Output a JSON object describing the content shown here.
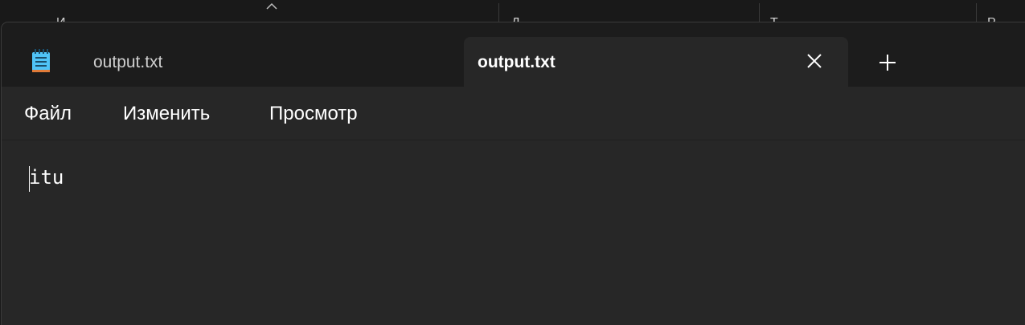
{
  "background_window": {
    "column_labels": [
      "И",
      "Д",
      "Т",
      "Р"
    ]
  },
  "notepad": {
    "tabs": [
      {
        "label": "output.txt",
        "active": false
      },
      {
        "label": "output.txt",
        "active": true
      }
    ],
    "menu": {
      "file": "Файл",
      "edit": "Изменить",
      "view": "Просмотр"
    },
    "editor": {
      "content": "itu"
    }
  },
  "colors": {
    "titlebar": "#1c1c1c",
    "surface": "#272727",
    "text": "#ffffff",
    "muted_text": "#cfcfcf",
    "icon_accent": "#4fc3f7"
  },
  "icons": [
    "notepad-icon",
    "close-icon",
    "plus-icon",
    "sort-caret-icon"
  ]
}
